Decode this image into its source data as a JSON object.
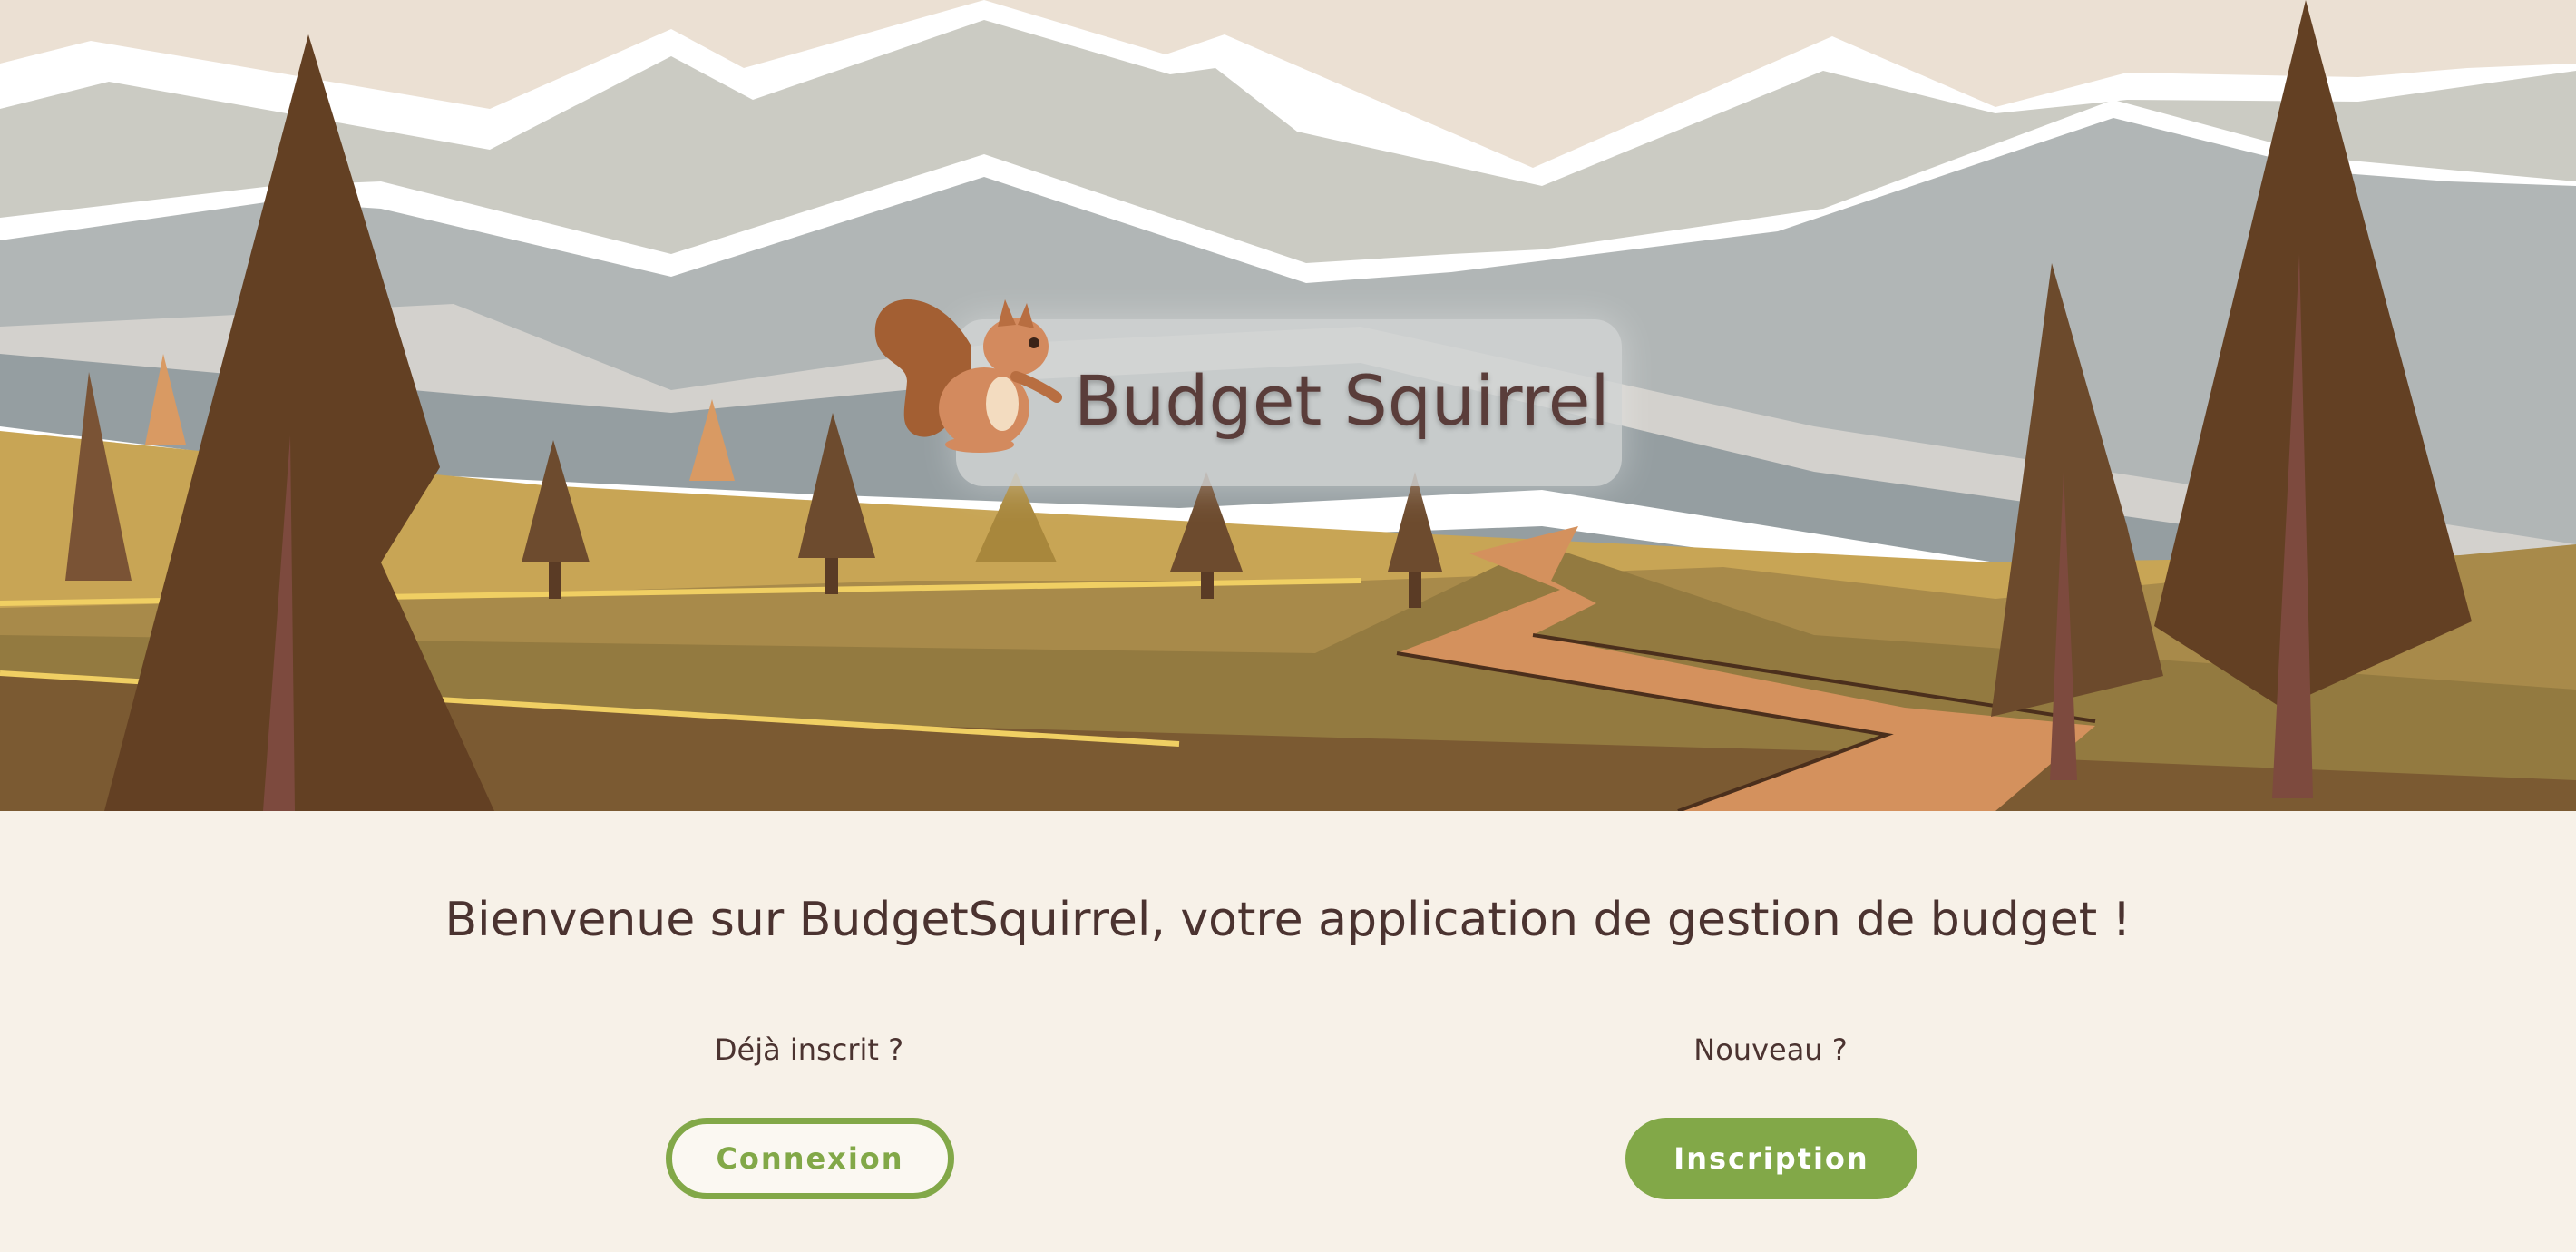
{
  "app": {
    "title": "Budget Squirrel"
  },
  "hero": {
    "illustration": "autumn-mountain-landscape",
    "mascot_icon": "squirrel-icon"
  },
  "welcome": {
    "message": "Bienvenue sur BudgetSquirrel, votre application de gestion de budget !"
  },
  "login": {
    "prompt": "Déjà inscrit ?",
    "button_label": "Connexion"
  },
  "signup": {
    "prompt": "Nouveau ?",
    "button_label": "Inscription"
  },
  "colors": {
    "accent": "#82a848",
    "text": "#4b3330",
    "page_background": "#f7f1e8",
    "title_text": "#5a3d3a"
  }
}
